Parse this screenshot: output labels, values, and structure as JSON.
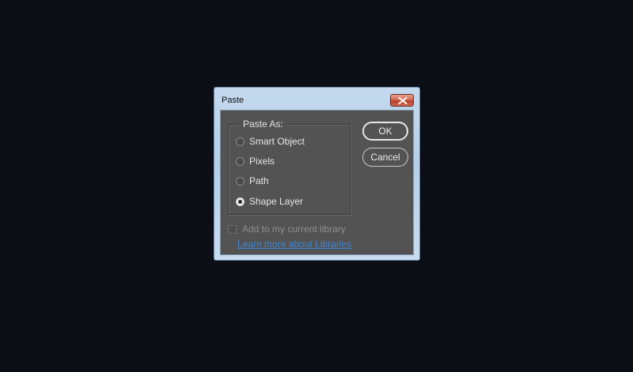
{
  "dialog": {
    "title": "Paste",
    "paste_as": {
      "legend": "Paste As:",
      "options": [
        {
          "label": "Smart Object",
          "checked": false
        },
        {
          "label": "Pixels",
          "checked": false
        },
        {
          "label": "Path",
          "checked": false
        },
        {
          "label": "Shape Layer",
          "checked": true
        }
      ]
    },
    "ok_label": "OK",
    "cancel_label": "Cancel",
    "library_checkbox": {
      "label": "Add to my current library",
      "checked": false,
      "enabled": false
    },
    "learn_more_link": "Learn more about Libraries"
  },
  "colors": {
    "desktop": "#0c0e16",
    "dialog_body": "#535353",
    "link": "#3d86d8",
    "close_button": "#c8523c"
  },
  "icons": {
    "close": "close-icon"
  }
}
